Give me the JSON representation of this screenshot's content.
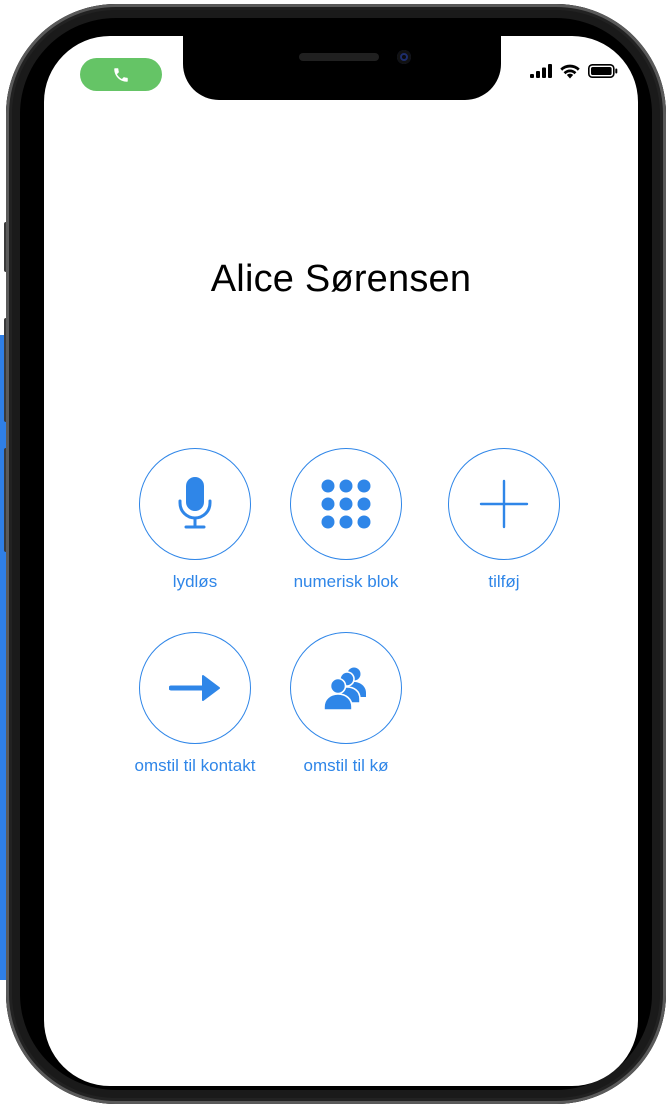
{
  "status_bar": {
    "active_call_icon": "phone-icon",
    "signal_icon": "cellular-signal-icon",
    "wifi_icon": "wifi-icon",
    "battery_icon": "battery-icon"
  },
  "call": {
    "caller_name": "Alice Sørensen"
  },
  "actions": [
    {
      "label": "lydløs",
      "icon": "microphone-icon"
    },
    {
      "label": "numerisk blok",
      "icon": "keypad-icon"
    },
    {
      "label": "tilføj",
      "icon": "plus-icon"
    },
    {
      "label": "omstil til kontakt",
      "icon": "arrow-right-icon"
    },
    {
      "label": "omstil til kø",
      "icon": "group-icon"
    }
  ],
  "colors": {
    "accent": "#2f86e8",
    "call_pill": "#65c466"
  }
}
